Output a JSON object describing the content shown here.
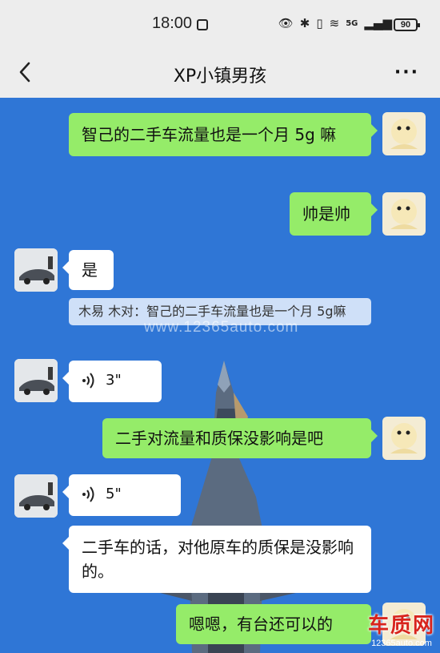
{
  "status_bar": {
    "time": "18:00",
    "network": "5G",
    "battery": "90"
  },
  "header": {
    "title": "XP小镇男孩"
  },
  "messages": [
    {
      "side": "right",
      "type": "text",
      "text": "智己的二手车流量也是一个月 5g 嘛"
    },
    {
      "side": "right",
      "type": "text",
      "text": "帅是帅"
    },
    {
      "side": "left",
      "type": "text",
      "text": "是"
    },
    {
      "side": "left",
      "type": "quote",
      "text": "木易 木对：智己的二手车流量也是一个月 5g嘛"
    },
    {
      "side": "left",
      "type": "voice",
      "duration": "3\""
    },
    {
      "side": "right",
      "type": "text",
      "text": "二手对流量和质保没影响是吧"
    },
    {
      "side": "left",
      "type": "voice",
      "duration": "5\""
    },
    {
      "side": "left",
      "type": "text",
      "text": "二手车的话，对他原车的质保是没影响的。"
    },
    {
      "side": "right",
      "type": "text",
      "text": "嗯嗯，有台还可以的"
    }
  ],
  "watermark": "www.12365auto.com",
  "logo": {
    "main": "车质网",
    "sub": "12365auto.com"
  },
  "colors": {
    "chat_bg": "#2f76d6",
    "green_bubble": "#95ec69",
    "white_bubble": "#ffffff"
  }
}
